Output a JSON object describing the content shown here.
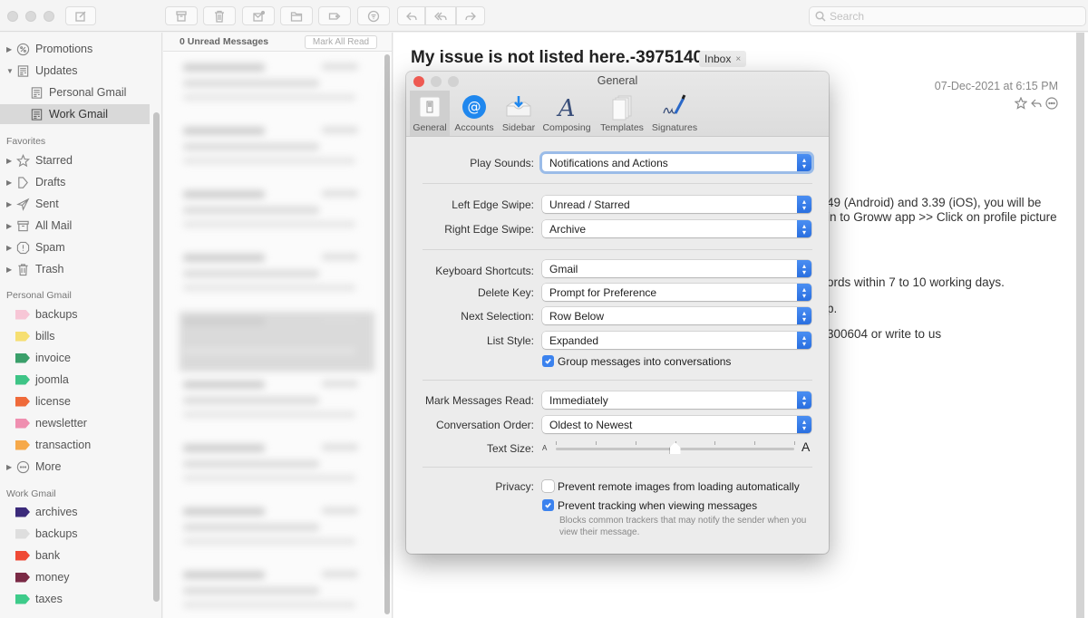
{
  "toolbar": {
    "buttons": [
      {
        "name": "compose",
        "icon": "compose-icon"
      },
      {
        "name": "archive",
        "icon": "archive-icon"
      },
      {
        "name": "delete",
        "icon": "trash-icon"
      },
      {
        "name": "junk",
        "icon": "junk-icon"
      },
      {
        "name": "move",
        "icon": "folder-icon"
      },
      {
        "name": "label",
        "icon": "tag-icon"
      },
      {
        "name": "filter",
        "icon": "filter-icon"
      },
      {
        "name": "reply",
        "icon": "reply-icon"
      },
      {
        "name": "reply-all",
        "icon": "reply-all-icon"
      },
      {
        "name": "forward",
        "icon": "forward-icon"
      }
    ],
    "search_placeholder": "Search"
  },
  "sidebar": {
    "mailboxes": [
      {
        "label": "Promotions",
        "icon": "percent-icon",
        "disclosure": "collapsed"
      },
      {
        "label": "Updates",
        "icon": "updates-icon",
        "disclosure": "expanded"
      },
      {
        "label": "Personal Gmail",
        "icon": "updates-icon",
        "disclosure": "none"
      },
      {
        "label": "Work Gmail",
        "icon": "updates-icon",
        "disclosure": "none",
        "selected": true
      }
    ],
    "favorites_header": "Favorites",
    "favorites": [
      {
        "label": "Starred",
        "icon": "star-icon"
      },
      {
        "label": "Drafts",
        "icon": "drafts-icon"
      },
      {
        "label": "Sent",
        "icon": "sent-icon"
      },
      {
        "label": "All Mail",
        "icon": "archive-icon"
      },
      {
        "label": "Spam",
        "icon": "spam-icon"
      },
      {
        "label": "Trash",
        "icon": "trash-icon"
      }
    ],
    "personal_header": "Personal Gmail",
    "personal_labels": [
      {
        "label": "backups",
        "color": "#f7c6d6"
      },
      {
        "label": "bills",
        "color": "#f6df72"
      },
      {
        "label": "invoice",
        "color": "#3a9f6a"
      },
      {
        "label": "joomla",
        "color": "#3ec486"
      },
      {
        "label": "license",
        "color": "#ef6a3a"
      },
      {
        "label": "newsletter",
        "color": "#ef8fb0"
      },
      {
        "label": "transaction",
        "color": "#f6a94a"
      }
    ],
    "more_label": "More",
    "work_header": "Work Gmail",
    "work_labels": [
      {
        "label": "archives",
        "color": "#3b2a7a"
      },
      {
        "label": "backups",
        "color": "#dedede"
      },
      {
        "label": "bank",
        "color": "#ef4a35"
      },
      {
        "label": "money",
        "color": "#7a2a45"
      },
      {
        "label": "taxes",
        "color": "#3ecb8a"
      }
    ]
  },
  "message_list": {
    "count_label": "0 Unread Messages",
    "mark_all_read": "Mark All Read"
  },
  "message": {
    "subject": "My issue is not listed here.-3975140",
    "mailbox_badge": "Inbox",
    "badge_close": "×",
    "date": "07-Dec-2021 at 6:15 PM",
    "body_fragments": [
      "49 (Android) and 3.39 (iOS), you will be",
      "in to Groww app >> Click on profile picture",
      "ords within 7 to 10 working days.",
      "p.",
      "300604 or write to us"
    ]
  },
  "preferences": {
    "title": "General",
    "tabs": [
      {
        "label": "General",
        "icon": "general-switch-icon",
        "active": true
      },
      {
        "label": "Accounts",
        "icon": "at-sign-icon"
      },
      {
        "label": "Sidebar",
        "icon": "sidebar-tray-icon"
      },
      {
        "label": "Composing",
        "icon": "composing-a-icon"
      },
      {
        "label": "Templates",
        "icon": "templates-pages-icon"
      },
      {
        "label": "Signatures",
        "icon": "signature-pen-icon"
      }
    ],
    "settings": {
      "play_sounds": {
        "label": "Play Sounds:",
        "value": "Notifications and Actions"
      },
      "left_edge_swipe": {
        "label": "Left Edge Swipe:",
        "value": "Unread / Starred"
      },
      "right_edge_swipe": {
        "label": "Right Edge Swipe:",
        "value": "Archive"
      },
      "keyboard_shortcuts": {
        "label": "Keyboard Shortcuts:",
        "value": "Gmail"
      },
      "delete_key": {
        "label": "Delete Key:",
        "value": "Prompt for Preference"
      },
      "next_selection": {
        "label": "Next Selection:",
        "value": "Row Below"
      },
      "list_style": {
        "label": "List Style:",
        "value": "Expanded"
      },
      "group_conversations": {
        "label": "Group messages into conversations",
        "checked": true
      },
      "mark_read": {
        "label": "Mark Messages Read:",
        "value": "Immediately"
      },
      "conversation_order": {
        "label": "Conversation Order:",
        "value": "Oldest to Newest"
      },
      "text_size": {
        "label": "Text Size:",
        "small_glyph": "A",
        "large_glyph": "A",
        "steps": 7,
        "value_index": 3
      },
      "privacy_label": "Privacy:",
      "prevent_remote_images": {
        "label": "Prevent remote images from loading automatically",
        "checked": false
      },
      "prevent_tracking": {
        "label": "Prevent tracking when viewing messages",
        "checked": true
      },
      "tracking_hint": "Blocks common trackers that may notify the sender when you view their message."
    }
  }
}
